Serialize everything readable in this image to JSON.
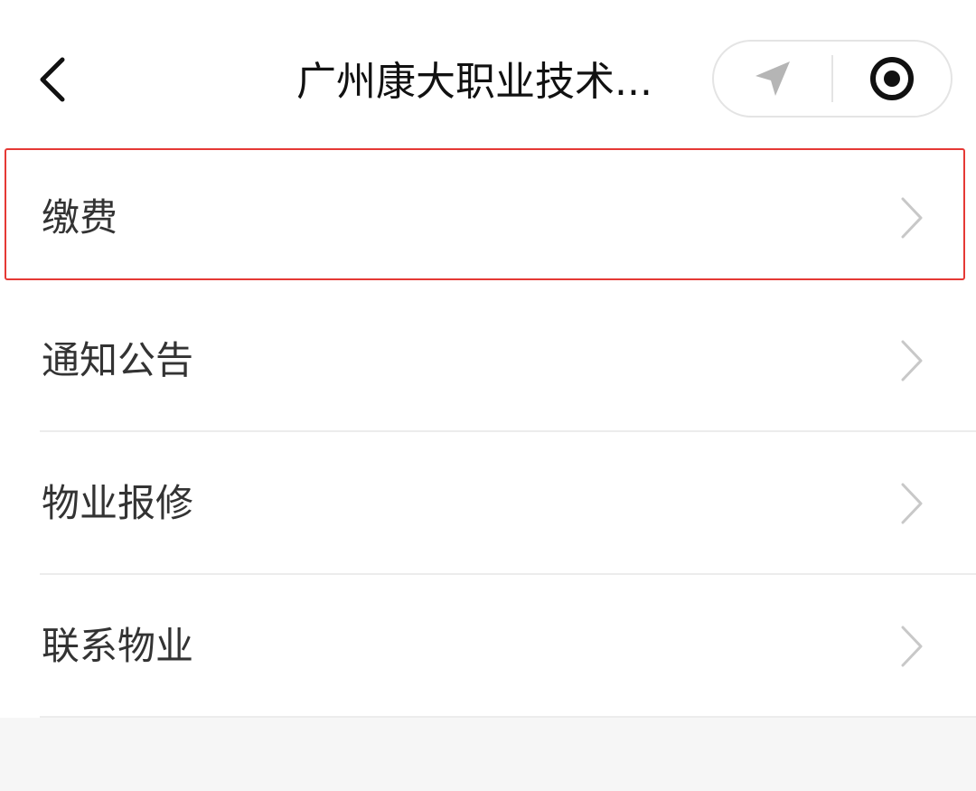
{
  "navbar": {
    "back_icon": "chevron-left-icon",
    "title": "广州康大职业技术...",
    "capsule": {
      "left_icon": "location-arrow-icon",
      "right_icon": "record-target-icon"
    }
  },
  "menu": {
    "items": [
      {
        "label": "缴费",
        "icon": "chevron-right-icon",
        "highlighted": true
      },
      {
        "label": "通知公告",
        "icon": "chevron-right-icon"
      },
      {
        "label": "物业报修",
        "icon": "chevron-right-icon"
      },
      {
        "label": "联系物业",
        "icon": "chevron-right-icon"
      }
    ]
  },
  "colors": {
    "highlight_border": "#e53935",
    "page_background": "#f6f6f6",
    "text": "#333333",
    "chevron": "#c8c8c8"
  }
}
